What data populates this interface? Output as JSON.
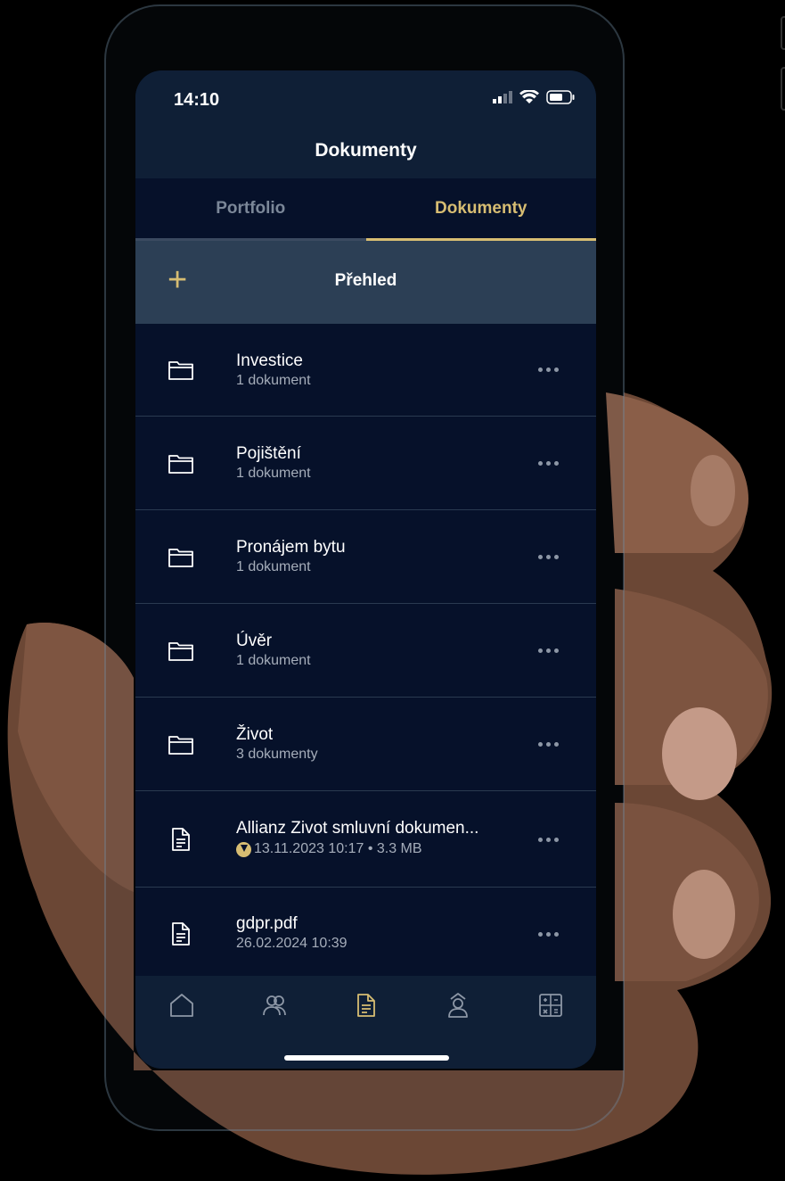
{
  "status_bar": {
    "time": "14:10"
  },
  "header": {
    "title": "Dokumenty"
  },
  "tabs": [
    {
      "label": "Portfolio",
      "active": false
    },
    {
      "label": "Dokumenty",
      "active": true
    }
  ],
  "overview": {
    "add_icon": "plus-icon",
    "label": "Přehled"
  },
  "folders": [
    {
      "name": "Investice",
      "count": "1 dokument"
    },
    {
      "name": "Pojištění",
      "count": "1 dokument"
    },
    {
      "name": "Pronájem bytu",
      "count": "1 dokument"
    },
    {
      "name": "Úvěr",
      "count": "1 dokument"
    },
    {
      "name": "Život",
      "count": "3 dokumenty"
    }
  ],
  "files": [
    {
      "name": "Allianz Zivot smluvní dokumen...",
      "meta": "13.11.2023 10:17 • 3.3 MB",
      "downloaded": true
    },
    {
      "name": "gdpr.pdf",
      "meta": "26.02.2024 10:39",
      "downloaded": false
    }
  ],
  "tab_bar": [
    {
      "icon": "home-icon",
      "active": false
    },
    {
      "icon": "people-icon",
      "active": false
    },
    {
      "icon": "document-icon",
      "active": true
    },
    {
      "icon": "advisor-icon",
      "active": false
    },
    {
      "icon": "calculator-icon",
      "active": false
    }
  ],
  "colors": {
    "accent": "#d7bd72",
    "background": "#06112a",
    "header": "#0f1f36",
    "overview_bar": "#2c3f55"
  }
}
